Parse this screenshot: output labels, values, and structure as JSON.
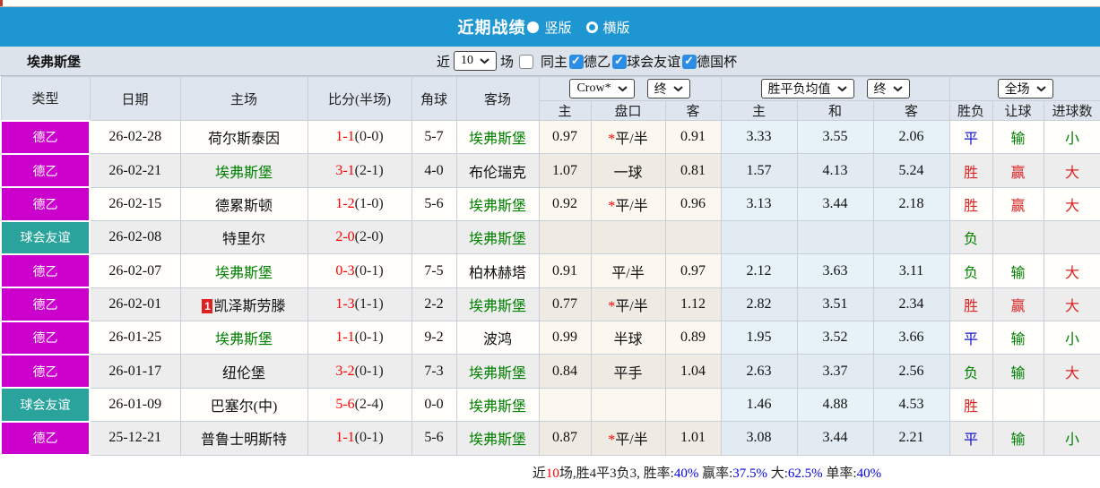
{
  "colors": {
    "accent_blue": "#1e96d2",
    "league_de2": "#cc00cc",
    "league_friendly": "#2aa39c",
    "checkbox_blue": "#2d8de4",
    "self_green": "#008000",
    "score_red": "#ff0000",
    "win_red": "#dd2222",
    "draw_blue": "#1515cc",
    "lose_green": "#008000",
    "stat_blue": "#0000dd",
    "stat_red": "#ff0000"
  },
  "title_bar": {
    "title": "近期战绩",
    "options": [
      {
        "label": "竖版",
        "selected": true
      },
      {
        "label": "横版",
        "selected": false
      }
    ]
  },
  "filter_bar": {
    "team": "埃弗斯堡",
    "near_label": "近",
    "recent_value": "10",
    "matches_label": "场",
    "checkboxes": [
      {
        "label": "同主",
        "checked": false
      },
      {
        "label": "德乙",
        "checked": true
      },
      {
        "label": "球会友谊",
        "checked": true
      },
      {
        "label": "德国杯",
        "checked": true
      }
    ]
  },
  "table": {
    "main_headers": [
      "类型",
      "日期",
      "主场",
      "比分(半场)",
      "角球",
      "客场"
    ],
    "selects": {
      "odds_market": "Crow*",
      "odds_stage": "终",
      "avg_market": "胜平负均值",
      "avg_stage": "终",
      "result_scope": "全场"
    },
    "sub_headers": [
      "主",
      "盘口",
      "客",
      "主",
      "和",
      "客",
      "胜负",
      "让球",
      "进球数"
    ],
    "rows": [
      {
        "league": "德乙",
        "lc": "#cc00cc",
        "date": "26-02-28",
        "home": "荷尔斯泰因",
        "hs": false,
        "score": "1-1",
        "half": "(0-0)",
        "corner": "5-7",
        "away": "埃弗斯堡",
        "aself": true,
        "o1": "0.97",
        "hstar": true,
        "hcap": "平/半",
        "o2": "0.91",
        "a1": "3.33",
        "a2": "3.55",
        "a3": "2.06",
        "r1": {
          "t": "平",
          "c": "b"
        },
        "r2": {
          "t": "输",
          "c": "g"
        },
        "r3": {
          "t": "小",
          "c": "g"
        }
      },
      {
        "league": "德乙",
        "lc": "#cc00cc",
        "date": "26-02-21",
        "home": "埃弗斯堡",
        "hs": true,
        "score": "3-1",
        "half": "(2-1)",
        "corner": "4-0",
        "away": "布伦瑞克",
        "aself": false,
        "o1": "1.07",
        "hstar": false,
        "hcap": "一球",
        "o2": "0.81",
        "a1": "1.57",
        "a2": "4.13",
        "a3": "5.24",
        "r1": {
          "t": "胜",
          "c": "r"
        },
        "r2": {
          "t": "赢",
          "c": "r"
        },
        "r3": {
          "t": "大",
          "c": "r"
        }
      },
      {
        "league": "德乙",
        "lc": "#cc00cc",
        "date": "26-02-15",
        "home": "德累斯顿",
        "hs": false,
        "score": "1-2",
        "half": "(1-0)",
        "corner": "5-6",
        "away": "埃弗斯堡",
        "aself": true,
        "o1": "0.92",
        "hstar": true,
        "hcap": "平/半",
        "o2": "0.96",
        "a1": "3.13",
        "a2": "3.44",
        "a3": "2.18",
        "r1": {
          "t": "胜",
          "c": "r"
        },
        "r2": {
          "t": "赢",
          "c": "r"
        },
        "r3": {
          "t": "大",
          "c": "r"
        }
      },
      {
        "league": "球会友谊",
        "lc": "#2aa39c",
        "date": "26-02-08",
        "home": "特里尔",
        "hs": false,
        "score": "2-0",
        "half": "(2-0)",
        "corner": "",
        "away": "埃弗斯堡",
        "aself": true,
        "o1": "",
        "hstar": false,
        "hcap": "",
        "o2": "",
        "a1": "",
        "a2": "",
        "a3": "",
        "r1": {
          "t": "负",
          "c": "g"
        },
        "r2": null,
        "r3": null
      },
      {
        "league": "德乙",
        "lc": "#cc00cc",
        "date": "26-02-07",
        "home": "埃弗斯堡",
        "hs": true,
        "score": "0-3",
        "half": "(0-1)",
        "corner": "7-5",
        "away": "柏林赫塔",
        "aself": false,
        "o1": "0.91",
        "hstar": false,
        "hcap": "平/半",
        "o2": "0.97",
        "a1": "2.12",
        "a2": "3.63",
        "a3": "3.11",
        "r1": {
          "t": "负",
          "c": "g"
        },
        "r2": {
          "t": "输",
          "c": "g"
        },
        "r3": {
          "t": "大",
          "c": "r"
        }
      },
      {
        "league": "德乙",
        "lc": "#cc00cc",
        "date": "26-02-01",
        "home": "凯泽斯劳滕",
        "rc": "1",
        "hs": false,
        "score": "1-3",
        "half": "(1-1)",
        "corner": "2-2",
        "away": "埃弗斯堡",
        "aself": true,
        "o1": "0.77",
        "hstar": true,
        "hcap": "平/半",
        "o2": "1.12",
        "a1": "2.82",
        "a2": "3.51",
        "a3": "2.34",
        "r1": {
          "t": "胜",
          "c": "r"
        },
        "r2": {
          "t": "赢",
          "c": "r"
        },
        "r3": {
          "t": "大",
          "c": "r"
        }
      },
      {
        "league": "德乙",
        "lc": "#cc00cc",
        "date": "26-01-25",
        "home": "埃弗斯堡",
        "hs": true,
        "score": "1-1",
        "half": "(0-1)",
        "corner": "9-2",
        "away": "波鸿",
        "aself": false,
        "o1": "0.99",
        "hstar": false,
        "hcap": "半球",
        "o2": "0.89",
        "a1": "1.95",
        "a2": "3.52",
        "a3": "3.66",
        "r1": {
          "t": "平",
          "c": "b"
        },
        "r2": {
          "t": "输",
          "c": "g"
        },
        "r3": {
          "t": "小",
          "c": "g"
        }
      },
      {
        "league": "德乙",
        "lc": "#cc00cc",
        "date": "26-01-17",
        "home": "纽伦堡",
        "hs": false,
        "score": "3-2",
        "half": "(0-1)",
        "corner": "7-3",
        "away": "埃弗斯堡",
        "aself": true,
        "o1": "0.84",
        "hstar": false,
        "hcap": "平手",
        "o2": "1.04",
        "a1": "2.63",
        "a2": "3.37",
        "a3": "2.56",
        "r1": {
          "t": "负",
          "c": "g"
        },
        "r2": {
          "t": "输",
          "c": "g"
        },
        "r3": {
          "t": "大",
          "c": "r"
        }
      },
      {
        "league": "球会友谊",
        "lc": "#2aa39c",
        "date": "26-01-09",
        "home": "巴塞尔(中)",
        "hs": false,
        "score": "5-6",
        "half": "(2-4)",
        "corner": "0-0",
        "away": "埃弗斯堡",
        "aself": true,
        "o1": "",
        "hstar": false,
        "hcap": "",
        "o2": "",
        "a1": "1.46",
        "a2": "4.88",
        "a3": "4.53",
        "r1": {
          "t": "胜",
          "c": "r"
        },
        "r2": null,
        "r3": null
      },
      {
        "league": "德乙",
        "lc": "#cc00cc",
        "date": "25-12-21",
        "home": "普鲁士明斯特",
        "hs": false,
        "score": "1-1",
        "half": "(0-1)",
        "corner": "5-6",
        "away": "埃弗斯堡",
        "aself": true,
        "o1": "0.87",
        "hstar": true,
        "hcap": "平/半",
        "o2": "1.01",
        "a1": "3.08",
        "a2": "3.44",
        "a3": "2.21",
        "r1": {
          "t": "平",
          "c": "b"
        },
        "r2": {
          "t": "输",
          "c": "g"
        },
        "r3": {
          "t": "小",
          "c": "g"
        }
      }
    ]
  },
  "footer": {
    "tokens": [
      {
        "t": "近",
        "c": "#222222"
      },
      {
        "t": "10",
        "c": "#ff0000"
      },
      {
        "t": "场,胜4平3负3, 胜率:",
        "c": "#222222"
      },
      {
        "t": "40%",
        "c": "#0000dd"
      },
      {
        "t": " 赢率:",
        "c": "#222222"
      },
      {
        "t": "37.5%",
        "c": "#0000dd"
      },
      {
        "t": " 大:",
        "c": "#222222"
      },
      {
        "t": "62.5%",
        "c": "#0000dd"
      },
      {
        "t": " 单率:",
        "c": "#222222"
      },
      {
        "t": "40%",
        "c": "#0000dd"
      }
    ]
  }
}
